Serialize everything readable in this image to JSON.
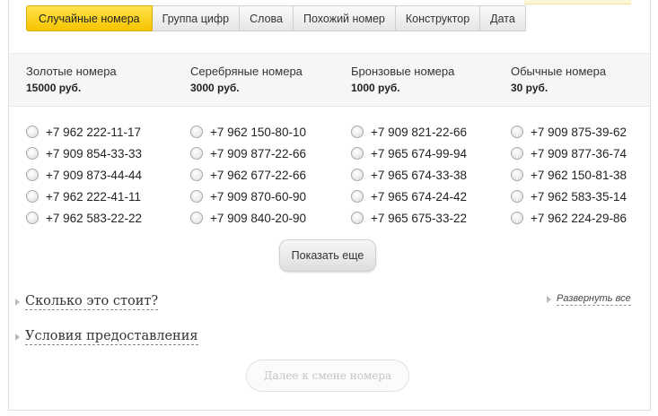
{
  "tabs": [
    "Случайные номера",
    "Группа цифр",
    "Слова",
    "Похожий номер",
    "Конструктор",
    "Дата"
  ],
  "categories": [
    {
      "name": "Золотые номера",
      "price": "15000 руб.",
      "numbers": [
        "+7 962 222-11-17",
        "+7 909 854-33-33",
        "+7 909 873-44-44",
        "+7 962 222-41-11",
        "+7 962 583-22-22"
      ]
    },
    {
      "name": "Серебряные номера",
      "price": "3000 руб.",
      "numbers": [
        "+7 962 150-80-10",
        "+7 909 877-22-66",
        "+7 962 677-22-66",
        "+7 909 870-60-90",
        "+7 909 840-20-90"
      ]
    },
    {
      "name": "Бронзовые номера",
      "price": "1000 руб.",
      "numbers": [
        "+7 909 821-22-66",
        "+7 965 674-99-94",
        "+7 965 674-33-38",
        "+7 965 674-24-42",
        "+7 965 675-33-22"
      ]
    },
    {
      "name": "Обычные номера",
      "price": "30 руб.",
      "numbers": [
        "+7 909 875-39-62",
        "+7 909 877-36-74",
        "+7 962 150-81-38",
        "+7 962 583-35-14",
        "+7 962 224-29-86"
      ]
    }
  ],
  "show_more_label": "Показать еще",
  "accordion": {
    "cost_label": "Сколько это стоит?",
    "terms_label": "Условия предоставления",
    "expand_all_label": "Развернуть все"
  },
  "next_button_label": "Далее к смене номера",
  "colors": {
    "active_tab": "#f5c400",
    "disabled_text": "#c4c4c4"
  }
}
